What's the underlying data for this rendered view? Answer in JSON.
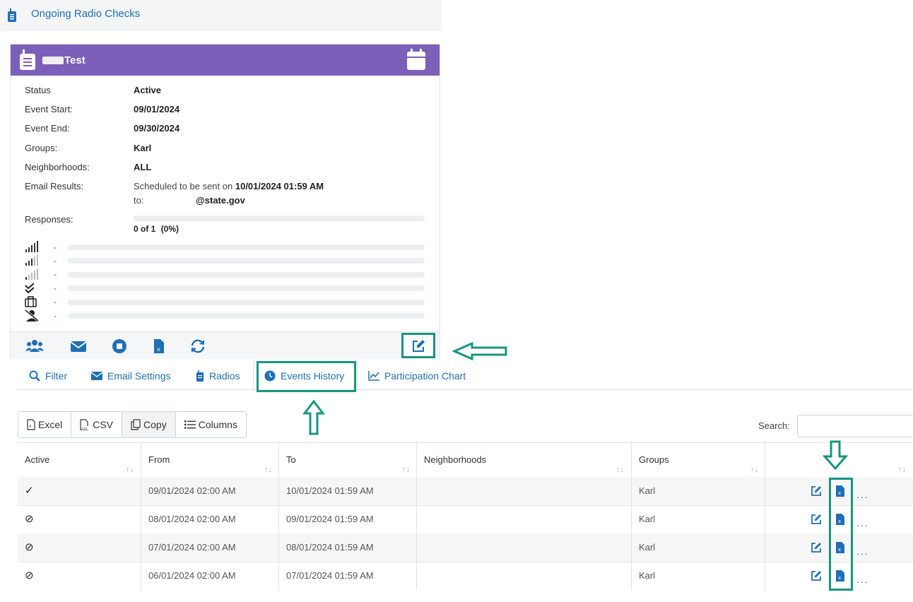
{
  "header": {
    "title": "Ongoing Radio Checks"
  },
  "card": {
    "title": "Test",
    "fields": {
      "status_label": "Status",
      "status_value": "Active",
      "start_label": "Event Start:",
      "start_value": "09/01/2024",
      "end_label": "Event End:",
      "end_value": "09/30/2024",
      "groups_label": "Groups:",
      "groups_value": "Karl",
      "neigh_label": "Neighborhoods:",
      "neigh_value": "ALL",
      "email_label": "Email Results:",
      "email_prefix": "Scheduled to be sent on",
      "email_datetime": "10/01/2024 01:59 AM",
      "email_to": "to:",
      "email_domain": "@state.gov",
      "responses_label": "Responses:",
      "responses_count": "0 of 1",
      "responses_pct": "(0%)",
      "responses_progress": 0
    },
    "signal_rows": [
      {
        "icon": "signal-full-icon",
        "text": "-"
      },
      {
        "icon": "signal-medium-icon",
        "text": "-"
      },
      {
        "icon": "signal-low-icon",
        "text": "-"
      },
      {
        "icon": "double-check-icon",
        "text": "-"
      },
      {
        "icon": "briefcase-icon",
        "text": "-"
      },
      {
        "icon": "user-slash-icon",
        "text": "-"
      }
    ]
  },
  "tabs": [
    {
      "label": "Filter",
      "icon": "search-icon"
    },
    {
      "label": "Email Settings",
      "icon": "envelope-icon"
    },
    {
      "label": "Radios",
      "icon": "radio-icon"
    },
    {
      "label": "Events History",
      "icon": "clock-icon",
      "active": true
    },
    {
      "label": "Participation Chart",
      "icon": "line-chart-icon"
    }
  ],
  "toolbar": {
    "excel": "Excel",
    "csv": "CSV",
    "copy": "Copy",
    "columns": "Columns",
    "search_label": "Search:"
  },
  "table": {
    "headers": [
      "Active",
      "From",
      "To",
      "Neighborhoods",
      "Groups",
      ""
    ],
    "rows": [
      {
        "active": "✓",
        "from": "09/01/2024 02:00 AM",
        "to": "10/01/2024 01:59 AM",
        "neighborhoods": "",
        "groups": "Karl"
      },
      {
        "active": "⊘",
        "from": "08/01/2024 02:00 AM",
        "to": "09/01/2024 01:59 AM",
        "neighborhoods": "",
        "groups": "Karl"
      },
      {
        "active": "⊘",
        "from": "07/01/2024 02:00 AM",
        "to": "08/01/2024 01:59 AM",
        "neighborhoods": "",
        "groups": "Karl"
      },
      {
        "active": "⊘",
        "from": "06/01/2024 02:00 AM",
        "to": "07/01/2024 01:59 AM",
        "neighborhoods": "",
        "groups": "Karl"
      }
    ]
  },
  "colors": {
    "accent": "#1f6fb5",
    "card_header": "#7b5fb8",
    "highlight": "#17967f"
  }
}
